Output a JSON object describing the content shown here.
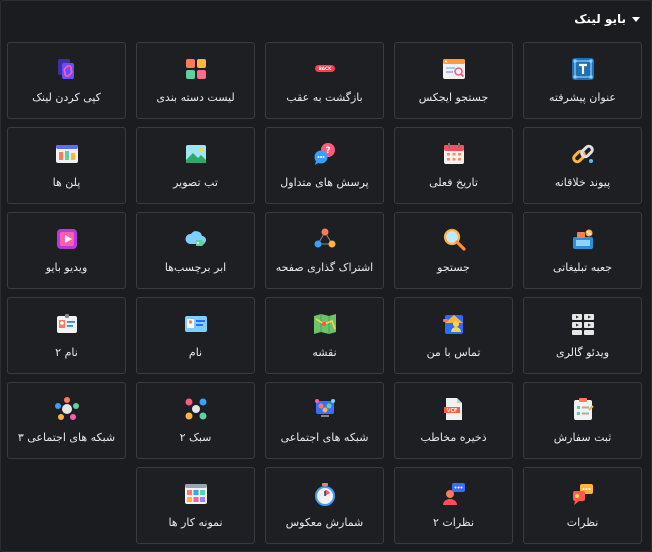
{
  "header": {
    "title": "بایو لینک"
  },
  "items": [
    {
      "label": "عنوان پیشرفته",
      "icon": "title-icon"
    },
    {
      "label": "جستجو ایجکس",
      "icon": "ajax-search-icon"
    },
    {
      "label": "بازگشت به عقب",
      "icon": "back-button-icon",
      "badge": "BACK"
    },
    {
      "label": "لیست دسته بندی",
      "icon": "category-list-icon"
    },
    {
      "label": "کپی کردن لینک",
      "icon": "copy-link-icon"
    },
    {
      "label": "پیوند خلاقانه",
      "icon": "creative-link-icon"
    },
    {
      "label": "تاریخ فعلی",
      "icon": "calendar-icon"
    },
    {
      "label": "پرسش های متداول",
      "icon": "faq-icon"
    },
    {
      "label": "تب تصویر",
      "icon": "image-tab-icon"
    },
    {
      "label": "پلن ها",
      "icon": "pricing-plans-icon"
    },
    {
      "label": "جعبه تبلیغاتی",
      "icon": "promo-box-icon"
    },
    {
      "label": "جستجو",
      "icon": "search-icon"
    },
    {
      "label": "اشتراک گذاری صفحه",
      "icon": "share-page-icon"
    },
    {
      "label": "ابر برچسب‌ها",
      "icon": "tag-cloud-icon"
    },
    {
      "label": "ویدیو بایو",
      "icon": "video-bio-icon"
    },
    {
      "label": "ویدئو گالری",
      "icon": "video-gallery-icon"
    },
    {
      "label": "تماس با من",
      "icon": "contact-me-icon"
    },
    {
      "label": "نقشه",
      "icon": "map-icon"
    },
    {
      "label": "نام",
      "icon": "name-card-icon"
    },
    {
      "label": "نام ۲",
      "icon": "name-card-2-icon"
    },
    {
      "label": "ثبت سفارش",
      "icon": "order-form-icon"
    },
    {
      "label": "ذخیره مخاطب",
      "icon": "save-contact-icon",
      "badge": "VCF"
    },
    {
      "label": "شبکه های اجتماعی",
      "icon": "social-networks-icon"
    },
    {
      "label": "سبک ۲",
      "icon": "social-style-2-icon"
    },
    {
      "label": "شبکه های اجتماعی ۳",
      "icon": "social-networks-3-icon"
    },
    {
      "label": "نظرات",
      "icon": "testimonials-icon"
    },
    {
      "label": "نظرات ۲",
      "icon": "testimonials-2-icon"
    },
    {
      "label": "شمارش معکوس",
      "icon": "countdown-icon"
    },
    {
      "label": "نمونه کار ها",
      "icon": "portfolio-icon"
    }
  ]
}
